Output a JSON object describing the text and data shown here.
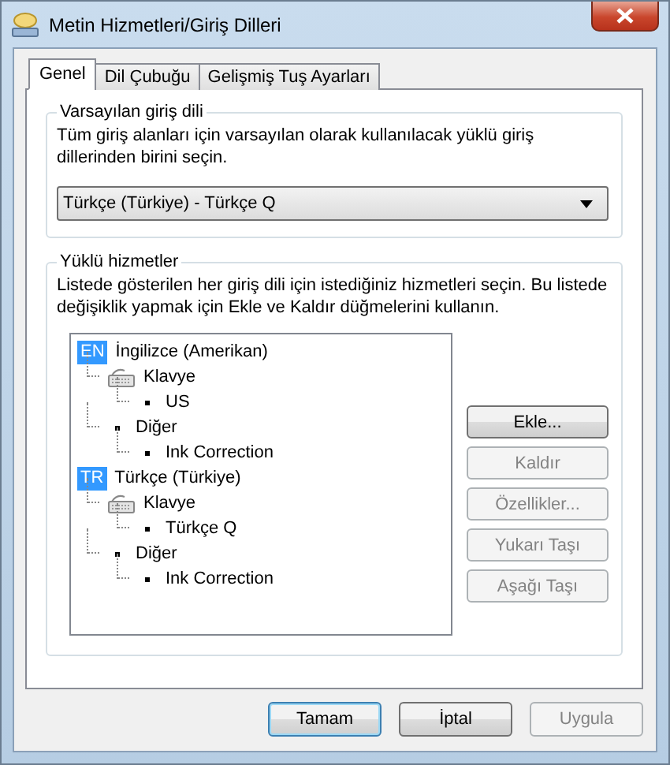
{
  "window": {
    "title": "Metin Hizmetleri/Giriş Dilleri"
  },
  "tabs": [
    {
      "label": "Genel",
      "selected": true
    },
    {
      "label": "Dil Çubuğu",
      "selected": false
    },
    {
      "label": "Gelişmiş Tuş Ayarları",
      "selected": false
    }
  ],
  "default_language": {
    "title": "Varsayılan giriş dili",
    "description": "Tüm giriş alanları için varsayılan olarak kullanılacak yüklü giriş dillerinden birini seçin.",
    "value": "Türkçe (Türkiye) - Türkçe Q"
  },
  "installed_services": {
    "title": "Yüklü hizmetler",
    "description": "Listede gösterilen her giriş dili için istediğiniz hizmetleri seçin. Bu listede değişiklik yapmak için Ekle ve Kaldır düğmelerini kullanın.",
    "tree": [
      {
        "kind": "language",
        "badge": "EN",
        "label": "İngilizce (Amerikan)",
        "children": [
          {
            "kind": "keyboard",
            "label": "Klavye",
            "children": [
              {
                "kind": "bullet",
                "label": "US"
              }
            ]
          },
          {
            "kind": "bullet",
            "label": "Diğer",
            "children": [
              {
                "kind": "bullet",
                "label": "Ink Correction"
              }
            ]
          }
        ]
      },
      {
        "kind": "language",
        "badge": "TR",
        "label": "Türkçe (Türkiye)",
        "children": [
          {
            "kind": "keyboard",
            "label": "Klavye",
            "children": [
              {
                "kind": "bullet",
                "label": "Türkçe Q"
              }
            ]
          },
          {
            "kind": "bullet",
            "label": "Diğer",
            "children": [
              {
                "kind": "bullet",
                "label": "Ink Correction"
              }
            ]
          }
        ]
      }
    ],
    "buttons": [
      {
        "label": "Ekle...",
        "disabled": false
      },
      {
        "label": "Kaldır",
        "disabled": true
      },
      {
        "label": "Özellikler...",
        "disabled": true
      },
      {
        "label": "Yukarı Taşı",
        "disabled": true
      },
      {
        "label": "Aşağı Taşı",
        "disabled": true
      }
    ]
  },
  "dialog_buttons": [
    {
      "label": "Tamam",
      "disabled": false,
      "focused": true
    },
    {
      "label": "İptal",
      "disabled": false,
      "focused": false
    },
    {
      "label": "Uygula",
      "disabled": true,
      "focused": false
    }
  ]
}
